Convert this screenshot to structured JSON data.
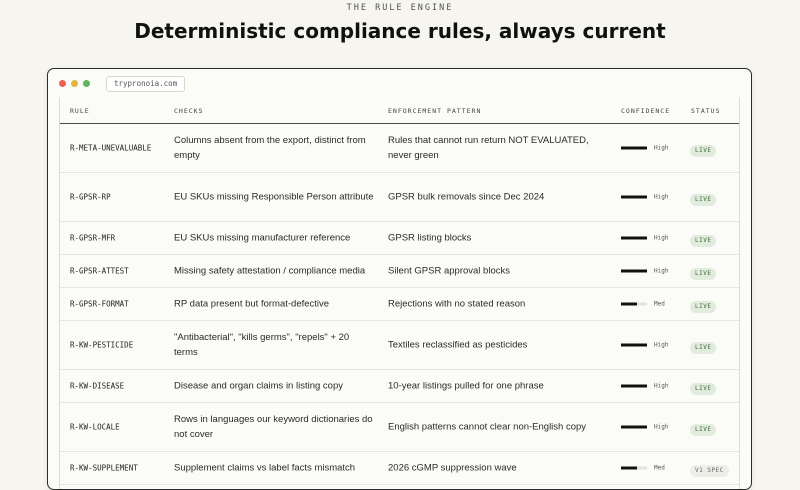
{
  "section": {
    "eyebrow": "THE RULE ENGINE",
    "headline": "Deterministic compliance rules, always current"
  },
  "browser": {
    "url": "trypronoia.com"
  },
  "table": {
    "headers": {
      "rule": "RULE",
      "checks": "CHECKS",
      "pattern": "ENFORCEMENT PATTERN",
      "confidence": "CONFIDENCE",
      "status": "STATUS"
    },
    "rows": [
      {
        "rule": "R-META-UNEVALUABLE",
        "checks": "Columns absent from the export, distinct from empty",
        "pattern": "Rules that cannot run return NOT EVALUATED, never green",
        "confidence": "High",
        "confidence_level": 1.0,
        "status": "LIVE",
        "status_kind": "live"
      },
      {
        "rule": "R-GPSR-RP",
        "checks": "EU SKUs missing Responsible Person attribute",
        "pattern": "GPSR bulk removals since Dec 2024",
        "confidence": "High",
        "confidence_level": 1.0,
        "status": "LIVE",
        "status_kind": "live"
      },
      {
        "rule": "R-GPSR-MFR",
        "checks": "EU SKUs missing manufacturer reference",
        "pattern": "GPSR listing blocks",
        "confidence": "High",
        "confidence_level": 1.0,
        "status": "LIVE",
        "status_kind": "live"
      },
      {
        "rule": "R-GPSR-ATTEST",
        "checks": "Missing safety attestation / compliance media",
        "pattern": "Silent GPSR approval blocks",
        "confidence": "High",
        "confidence_level": 1.0,
        "status": "LIVE",
        "status_kind": "live"
      },
      {
        "rule": "R-GPSR-FORMAT",
        "checks": "RP data present but format-defective",
        "pattern": "Rejections with no stated reason",
        "confidence": "Med",
        "confidence_level": 0.6,
        "status": "LIVE",
        "status_kind": "live"
      },
      {
        "rule": "R-KW-PESTICIDE",
        "checks": "\"Antibacterial\", \"kills germs\", \"repels\" + 20 terms",
        "pattern": "Textiles reclassified as pesticides",
        "confidence": "High",
        "confidence_level": 1.0,
        "status": "LIVE",
        "status_kind": "live"
      },
      {
        "rule": "R-KW-DISEASE",
        "checks": "Disease and organ claims in listing copy",
        "pattern": "10-year listings pulled for one phrase",
        "confidence": "High",
        "confidence_level": 1.0,
        "status": "LIVE",
        "status_kind": "live"
      },
      {
        "rule": "R-KW-LOCALE",
        "checks": "Rows in languages our keyword dictionaries do not cover",
        "pattern": "English patterns cannot clear non-English copy",
        "confidence": "High",
        "confidence_level": 1.0,
        "status": "LIVE",
        "status_kind": "live"
      },
      {
        "rule": "R-KW-SUPPLEMENT",
        "checks": "Supplement claims vs label facts mismatch",
        "pattern": "2026 cGMP suppression wave",
        "confidence": "Med",
        "confidence_level": 0.6,
        "status": "V1 SPEC",
        "status_kind": "spec"
      }
    ]
  }
}
